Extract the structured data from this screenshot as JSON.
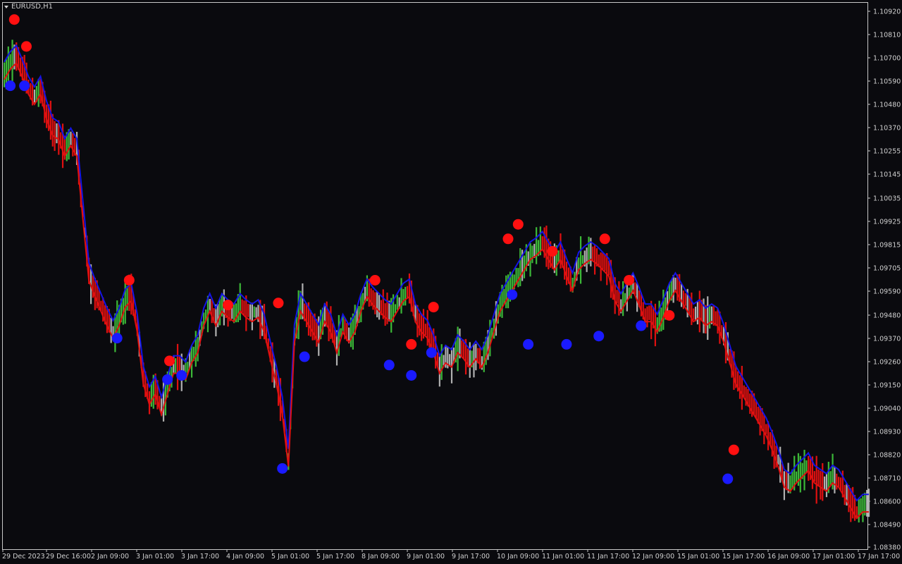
{
  "window": {
    "symbol_label": "EURUSD,H1"
  },
  "colors": {
    "background": "#0a0a0e",
    "frame": "#c8c8c8",
    "text": "#d0d0d0",
    "bull_bar": "#3cb838",
    "bear_bar": "#e01010",
    "neutral_bar": "#b0b0b0",
    "upper_band": "#1414e6",
    "lower_band": "#e01010",
    "sell_dot": "#ff1010",
    "buy_dot": "#1a1aff"
  },
  "chart_data": {
    "type": "bar",
    "ylim": [
      1.0838,
      1.1097
    ],
    "y_ticks": [
      "1.10920",
      "1.10810",
      "1.10700",
      "1.10590",
      "1.10480",
      "1.10370",
      "1.10255",
      "1.10145",
      "1.10035",
      "1.09925",
      "1.09815",
      "1.09705",
      "1.09590",
      "1.09480",
      "1.09370",
      "1.09260",
      "1.09150",
      "1.09040",
      "1.08930",
      "1.08820",
      "1.08710",
      "1.08600",
      "1.08490",
      "1.08380"
    ],
    "x_ticks": [
      "29 Dec 2023",
      "29 Dec 16:00",
      "2 Jan 09:00",
      "3 Jan 01:00",
      "3 Jan 17:00",
      "4 Jan 09:00",
      "5 Jan 01:00",
      "5 Jan 17:00",
      "8 Jan 09:00",
      "9 Jan 01:00",
      "9 Jan 17:00",
      "10 Jan 09:00",
      "11 Jan 01:00",
      "11 Jan 17:00",
      "12 Jan 09:00",
      "15 Jan 01:00",
      "15 Jan 17:00",
      "16 Jan 09:00",
      "17 Jan 01:00",
      "17 Jan 17:00"
    ],
    "anchors": [
      [
        0,
        1.1067
      ],
      [
        3,
        1.1072
      ],
      [
        6,
        1.1075
      ],
      [
        9,
        1.1068
      ],
      [
        12,
        1.106
      ],
      [
        15,
        1.1055
      ],
      [
        18,
        1.106
      ],
      [
        21,
        1.1048
      ],
      [
        24,
        1.104
      ],
      [
        27,
        1.1038
      ],
      [
        30,
        1.103
      ],
      [
        33,
        1.1035
      ],
      [
        36,
        1.103
      ],
      [
        39,
        1.1
      ],
      [
        42,
        1.097
      ],
      [
        45,
        1.0962
      ],
      [
        48,
        1.0955
      ],
      [
        51,
        1.0948
      ],
      [
        54,
        1.0942
      ],
      [
        57,
        1.0948
      ],
      [
        60,
        1.0957
      ],
      [
        63,
        1.096
      ],
      [
        66,
        1.0945
      ],
      [
        69,
        1.092
      ],
      [
        72,
        1.091
      ],
      [
        75,
        1.0915
      ],
      [
        78,
        1.0905
      ],
      [
        81,
        1.0915
      ],
      [
        84,
        1.0925
      ],
      [
        87,
        1.0925
      ],
      [
        90,
        1.0922
      ],
      [
        93,
        1.093
      ],
      [
        96,
        1.0935
      ],
      [
        99,
        1.0948
      ],
      [
        102,
        1.0955
      ],
      [
        105,
        1.0948
      ],
      [
        108,
        1.0955
      ],
      [
        111,
        1.0952
      ],
      [
        114,
        1.095
      ],
      [
        117,
        1.0955
      ],
      [
        120,
        1.0952
      ],
      [
        123,
        1.095
      ],
      [
        126,
        1.0952
      ],
      [
        129,
        1.0945
      ],
      [
        132,
        1.0932
      ],
      [
        135,
        1.092
      ],
      [
        138,
        1.0905
      ],
      [
        141,
        1.088
      ],
      [
        144,
        1.094
      ],
      [
        147,
        1.0955
      ],
      [
        150,
        1.095
      ],
      [
        153,
        1.0945
      ],
      [
        156,
        1.094
      ],
      [
        159,
        1.095
      ],
      [
        162,
        1.0945
      ],
      [
        165,
        1.0935
      ],
      [
        168,
        1.0945
      ],
      [
        171,
        1.094
      ],
      [
        174,
        1.0945
      ],
      [
        177,
        1.0955
      ],
      [
        180,
        1.0962
      ],
      [
        183,
        1.0958
      ],
      [
        186,
        1.0955
      ],
      [
        189,
        1.0952
      ],
      [
        192,
        1.095
      ],
      [
        195,
        1.0955
      ],
      [
        198,
        1.096
      ],
      [
        201,
        1.0962
      ],
      [
        204,
        1.095
      ],
      [
        207,
        1.0945
      ],
      [
        210,
        1.0942
      ],
      [
        213,
        1.0935
      ],
      [
        216,
        1.0925
      ],
      [
        219,
        1.093
      ],
      [
        222,
        1.0928
      ],
      [
        225,
        1.0935
      ],
      [
        228,
        1.0932
      ],
      [
        231,
        1.0928
      ],
      [
        234,
        1.0932
      ],
      [
        237,
        1.0928
      ],
      [
        240,
        1.0935
      ],
      [
        243,
        1.0945
      ],
      [
        246,
        1.0955
      ],
      [
        249,
        1.096
      ],
      [
        252,
        1.0965
      ],
      [
        255,
        1.097
      ],
      [
        258,
        1.0975
      ],
      [
        261,
        1.098
      ],
      [
        264,
        1.0982
      ],
      [
        267,
        1.0985
      ],
      [
        270,
        1.098
      ],
      [
        273,
        1.0975
      ],
      [
        276,
        1.098
      ],
      [
        279,
        1.0972
      ],
      [
        282,
        1.0965
      ],
      [
        285,
        1.0975
      ],
      [
        288,
        1.0978
      ],
      [
        291,
        1.098
      ],
      [
        294,
        1.0978
      ],
      [
        297,
        1.0975
      ],
      [
        300,
        1.0972
      ],
      [
        303,
        1.096
      ],
      [
        306,
        1.0955
      ],
      [
        309,
        1.096
      ],
      [
        312,
        1.0965
      ],
      [
        315,
        1.0958
      ],
      [
        318,
        1.095
      ],
      [
        321,
        1.095
      ],
      [
        324,
        1.0945
      ],
      [
        327,
        1.0952
      ],
      [
        330,
        1.096
      ],
      [
        333,
        1.0965
      ],
      [
        336,
        1.096
      ],
      [
        339,
        1.0955
      ],
      [
        342,
        1.095
      ],
      [
        345,
        1.0952
      ],
      [
        348,
        1.0948
      ],
      [
        351,
        1.095
      ],
      [
        354,
        1.0948
      ],
      [
        357,
        1.094
      ],
      [
        360,
        1.093
      ],
      [
        363,
        1.092
      ],
      [
        366,
        1.0915
      ],
      [
        369,
        1.091
      ],
      [
        372,
        1.0905
      ],
      [
        375,
        1.09
      ],
      [
        378,
        1.0895
      ],
      [
        381,
        1.0888
      ],
      [
        384,
        1.088
      ],
      [
        387,
        1.087
      ],
      [
        390,
        1.0868
      ],
      [
        393,
        1.0872
      ],
      [
        396,
        1.0875
      ],
      [
        399,
        1.0878
      ],
      [
        402,
        1.0872
      ],
      [
        405,
        1.087
      ],
      [
        408,
        1.0868
      ],
      [
        411,
        1.0872
      ],
      [
        414,
        1.087
      ],
      [
        417,
        1.0865
      ],
      [
        420,
        1.086
      ],
      [
        423,
        1.0855
      ],
      [
        426,
        1.0858
      ]
    ],
    "sell_signals": [
      [
        5,
        1.1093
      ],
      [
        11,
        1.108
      ],
      [
        62,
        1.0967
      ],
      [
        82,
        1.0928
      ],
      [
        111,
        1.0955
      ],
      [
        136,
        1.0956
      ],
      [
        184,
        1.0967
      ],
      [
        202,
        1.0936
      ],
      [
        213,
        1.0954
      ],
      [
        250,
        1.0987
      ],
      [
        255,
        1.0994
      ],
      [
        272,
        1.0981
      ],
      [
        298,
        1.0987
      ],
      [
        310,
        1.0967
      ],
      [
        330,
        1.095
      ],
      [
        362,
        1.0885
      ]
    ],
    "buy_signals": [
      [
        3,
        1.1061
      ],
      [
        10,
        1.1061
      ],
      [
        56,
        1.0939
      ],
      [
        81,
        1.0919
      ],
      [
        88,
        1.0921
      ],
      [
        138,
        1.0876
      ],
      [
        149,
        1.093
      ],
      [
        191,
        1.0926
      ],
      [
        202,
        1.0921
      ],
      [
        212,
        1.0932
      ],
      [
        252,
        1.096
      ],
      [
        260,
        1.0936
      ],
      [
        279,
        1.0936
      ],
      [
        295,
        1.094
      ],
      [
        316,
        1.0945
      ],
      [
        359,
        1.0871
      ]
    ]
  }
}
